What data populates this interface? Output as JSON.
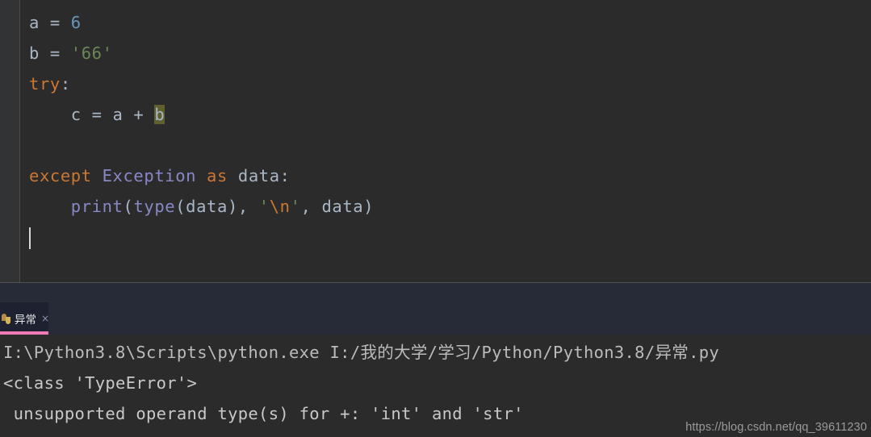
{
  "editor": {
    "lines": [
      {
        "id": "line-1",
        "tokens": [
          {
            "t": "a",
            "c": "var"
          },
          {
            "t": " = ",
            "c": "op"
          },
          {
            "t": "6",
            "c": "num"
          }
        ]
      },
      {
        "id": "line-2",
        "tokens": [
          {
            "t": "b",
            "c": "var"
          },
          {
            "t": " = ",
            "c": "op"
          },
          {
            "t": "'66'",
            "c": "str"
          }
        ]
      },
      {
        "id": "line-3",
        "tokens": [
          {
            "t": "try",
            "c": "kw"
          },
          {
            "t": ":",
            "c": "op"
          }
        ]
      },
      {
        "id": "line-4",
        "tokens": [
          {
            "t": "    c = a + ",
            "c": "var"
          },
          {
            "t": "b",
            "c": "hl"
          }
        ]
      },
      {
        "id": "line-5",
        "tokens": []
      },
      {
        "id": "line-6",
        "tokens": [
          {
            "t": "except",
            "c": "kw"
          },
          {
            "t": " ",
            "c": "op"
          },
          {
            "t": "Exception",
            "c": "class"
          },
          {
            "t": " ",
            "c": "op"
          },
          {
            "t": "as",
            "c": "kw"
          },
          {
            "t": " data:",
            "c": "var"
          }
        ]
      },
      {
        "id": "line-7",
        "tokens": [
          {
            "t": "    ",
            "c": "op"
          },
          {
            "t": "print",
            "c": "builtin"
          },
          {
            "t": "(",
            "c": "op"
          },
          {
            "t": "type",
            "c": "builtin"
          },
          {
            "t": "(data), ",
            "c": "op"
          },
          {
            "t": "'",
            "c": "str"
          },
          {
            "t": "\\n",
            "c": "esc"
          },
          {
            "t": "'",
            "c": "str"
          },
          {
            "t": ", data)",
            "c": "op"
          }
        ]
      },
      {
        "id": "line-8",
        "tokens": []
      }
    ],
    "caret_visible": true
  },
  "tool_window": {
    "tab": {
      "icon": "python-file-icon",
      "label": "异常",
      "close_label": "×",
      "underline_color": "#ef7bb6",
      "active": true
    },
    "console": {
      "lines": [
        "I:\\Python3.8\\Scripts\\python.exe I:/我的大学/学习/Python/Python3.8/异常.py",
        "<class 'TypeError'>",
        " unsupported operand type(s) for +: 'int' and 'str'"
      ]
    }
  },
  "watermark": {
    "text": "https://blog.csdn.net/qq_39611230"
  },
  "theme": {
    "editor_bg": "#2b2b2b",
    "gutter_bg": "#313335",
    "tabstrip_bg": "#272b38",
    "tab_bg": "#1d2130",
    "text": "#a9b7c6",
    "keyword": "#cc7832",
    "number": "#6897bb",
    "string": "#6a8759",
    "builtin": "#8888c6",
    "highlight": "#60602f",
    "console_text": "#bbbbbb"
  }
}
